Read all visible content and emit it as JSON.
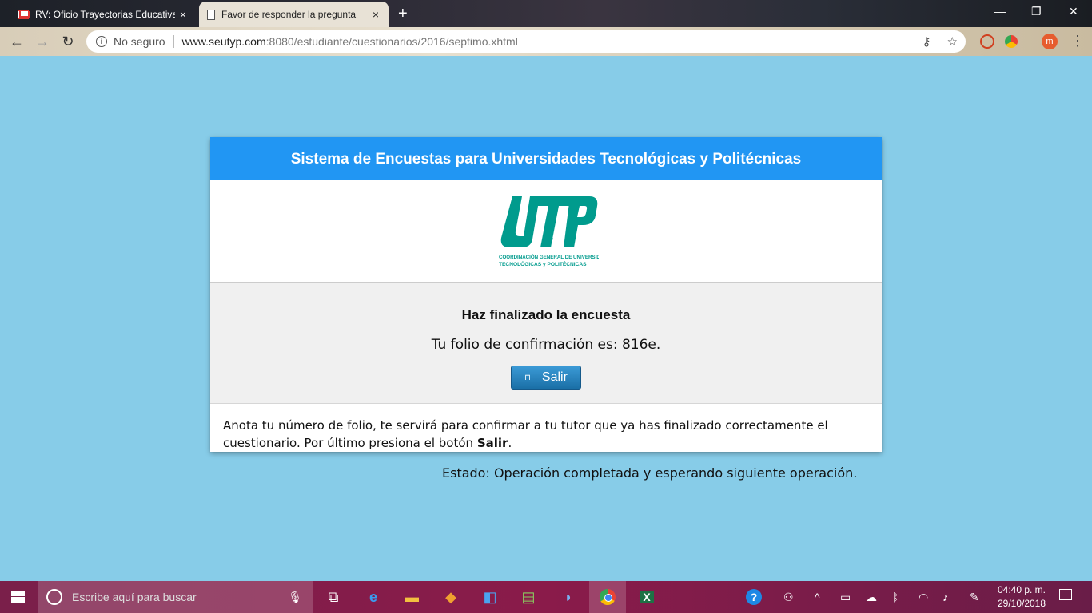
{
  "browser": {
    "tabs": [
      {
        "title": "RV: Oficio Trayectorias Educativa",
        "close": "×"
      },
      {
        "title": "Favor de responder la pregunta",
        "close": "×"
      }
    ],
    "new_tab": "+",
    "window_controls": {
      "minimize": "—",
      "restore": "❐",
      "close": "✕"
    },
    "security_label": "No seguro",
    "url_host": "www.seutyp.com",
    "url_path": ":8080/estudiante/cuestionarios/2016/septimo.xhtml",
    "profile_initial": "m"
  },
  "page": {
    "header_title": "Sistema de Encuestas para Universidades Tecnológicas y Politécnicas",
    "logo": {
      "letters": "UTyP",
      "line1": "COORDINACIÓN GENERAL DE UNIVERSIDADES",
      "line2": "TECNOLÓGICAS y POLITÉCNICAS",
      "color": "#009b8d"
    },
    "result_title": "Haz finalizado la encuesta",
    "folio_text": "Tu folio de confirmación es: 816e.",
    "salir_label": "Salir",
    "instructions_prefix": "Anota tu número de folio, te servirá para confirmar a tu tutor que ya has finalizado correctamente el cuestionario. Por último presiona el botón ",
    "instructions_bold": "Salir",
    "instructions_suffix": ".",
    "status_text": "Estado: Operación completada y esperando siguiente operación."
  },
  "taskbar": {
    "search_placeholder": "Escribe aquí para buscar",
    "time": "04:40 p. m.",
    "date": "29/10/2018"
  },
  "colors": {
    "background": "#87cce8",
    "header": "#2196f3",
    "button": "#1a6fa6"
  }
}
